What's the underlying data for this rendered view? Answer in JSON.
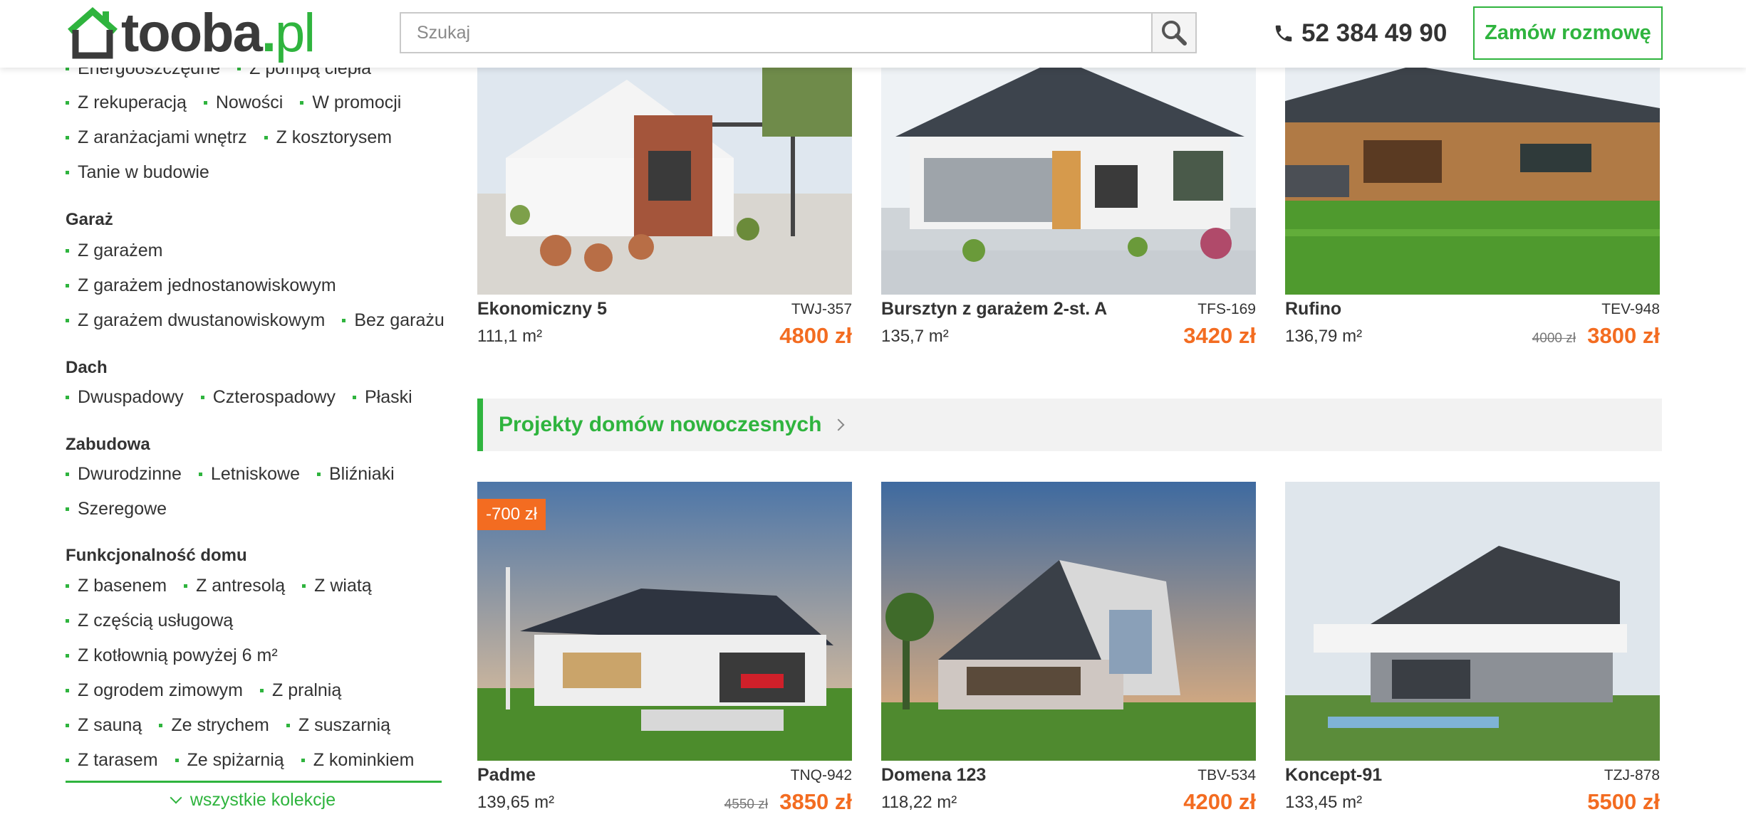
{
  "header": {
    "logo": {
      "part1": "tooba",
      "part2": ".",
      "part3": "pl"
    },
    "search_placeholder": "Szukaj",
    "phone": "52 384 49 90",
    "cta_label": "Zamów rozmowę"
  },
  "sidebar": {
    "line0": [
      "Energooszczędne",
      "Z pompą ciepła"
    ],
    "line1": [
      "Z rekuperacją",
      "Nowości",
      "W promocji"
    ],
    "line2": [
      "Z aranżacjami wnętrz",
      "Z kosztorysem"
    ],
    "line3": [
      "Tanie w budowie"
    ],
    "garage": {
      "heading": "Garaż",
      "line0": [
        "Z garażem"
      ],
      "line1": [
        "Z garażem jednostanowiskowym"
      ],
      "line2": [
        "Z garażem dwustanowiskowym",
        "Bez garażu"
      ]
    },
    "roof": {
      "heading": "Dach",
      "line0": [
        "Dwuspadowy",
        "Czterospadowy",
        "Płaski"
      ]
    },
    "building": {
      "heading": "Zabudowa",
      "line0": [
        "Dwurodzinne",
        "Letniskowe",
        "Bliźniaki"
      ],
      "line1": [
        "Szeregowe"
      ]
    },
    "function": {
      "heading": "Funkcjonalność domu",
      "line0": [
        "Z basenem",
        "Z antresolą",
        "Z wiatą"
      ],
      "line1": [
        "Z częścią usługową"
      ],
      "line2": [
        "Z kotłownią powyżej 6 m²"
      ],
      "line3": [
        "Z ogrodem zimowym",
        "Z pralnią"
      ],
      "line4": [
        "Z sauną",
        "Ze strychem",
        "Z suszarnią"
      ],
      "line5": [
        "Z tarasem",
        "Ze spiżarnią",
        "Z kominkiem"
      ]
    },
    "all_collections": "wszystkie kolekcje"
  },
  "section": {
    "title": "Projekty domów nowoczesnych"
  },
  "cards_top": [
    {
      "name": "Ekonomiczny 5",
      "code": "TWJ-357",
      "area": "111,1 m²",
      "price": "4800 zł",
      "old_price": ""
    },
    {
      "name": "Bursztyn z garażem 2-st. A",
      "code": "TFS-169",
      "area": "135,7 m²",
      "price": "3420 zł",
      "old_price": ""
    },
    {
      "name": "Rufino",
      "code": "TEV-948",
      "area": "136,79 m²",
      "price": "3800 zł",
      "old_price": "4000 zł"
    }
  ],
  "cards_bottom": [
    {
      "name": "Padme",
      "code": "TNQ-942",
      "area": "139,65 m²",
      "price": "3850 zł",
      "old_price": "4550 zł",
      "badge": "-700 zł"
    },
    {
      "name": "Domena 123",
      "code": "TBV-534",
      "area": "118,22 m²",
      "price": "4200 zł",
      "old_price": ""
    },
    {
      "name": "Koncept-91",
      "code": "TZJ-878",
      "area": "133,45 m²",
      "price": "5500 zł",
      "old_price": ""
    }
  ],
  "colors": {
    "brand_green": "#2fb43e",
    "price_orange": "#f36c21",
    "text": "#333333"
  }
}
